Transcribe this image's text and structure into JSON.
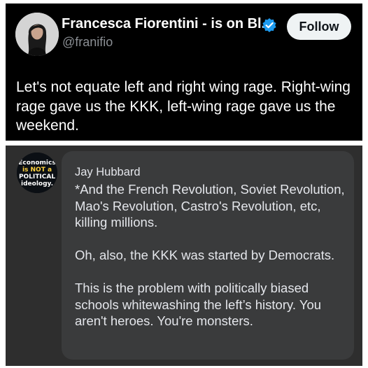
{
  "tweet": {
    "display_name": "Francesca Fiorentini - is on Bl...",
    "handle": "@franifio",
    "follow_label": "Follow",
    "text": "Let's not equate left and right wing rage. Right-wing rage gave us the KKK, left-wing rage gave us the weekend.",
    "avatar_icon": "profile-photo-woman",
    "verified_icon": "verified-badge-icon",
    "colors": {
      "background": "#000000",
      "verified": "#1d9bf0",
      "handle": "#8b8f94"
    }
  },
  "reply": {
    "author": "Jay Hubbard",
    "avatar_lines": [
      "Economics",
      "is NOT a",
      "POLITICAL",
      "ideology."
    ],
    "paragraphs": [
      "*And the French Revolution, Soviet Revolution, Mao's Revolution, Castro's Revolution, etc, killing millions.",
      "Oh, also, the KKK was started by Democrats.",
      "This is the problem with politically biased schools whitewashing the left’s history. You aren't heroes. You're monsters."
    ],
    "colors": {
      "background": "#2e2e2e",
      "bubble": "#3a3b3c",
      "text": "#e4e6eb"
    }
  }
}
